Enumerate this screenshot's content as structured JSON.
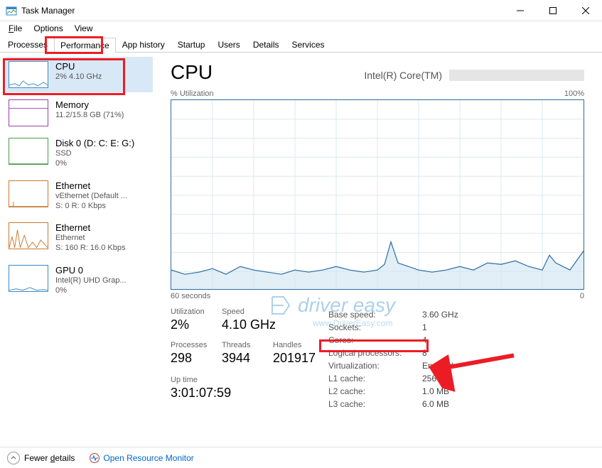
{
  "window": {
    "title": "Task Manager"
  },
  "menu": {
    "file": "File",
    "options": "Options",
    "view": "View"
  },
  "tabs": {
    "processes": "Processes",
    "performance": "Performance",
    "apphistory": "App history",
    "startup": "Startup",
    "users": "Users",
    "details": "Details",
    "services": "Services"
  },
  "sidebar": [
    {
      "name": "CPU",
      "sub1": "2%  4.10 GHz",
      "color": "#3b8bc4"
    },
    {
      "name": "Memory",
      "sub1": "11.2/15.8 GB (71%)",
      "color": "#9b3fb0"
    },
    {
      "name": "Disk 0 (D: C: E: G:)",
      "sub1": "SSD",
      "sub2": "0%",
      "color": "#4a9a4a"
    },
    {
      "name": "Ethernet",
      "sub1": "vEthernet (Default ...",
      "sub2": "S: 0  R: 0 Kbps",
      "color": "#c87b2e"
    },
    {
      "name": "Ethernet",
      "sub1": "Ethernet",
      "sub2": "S: 160  R: 16.0 Kbps",
      "color": "#c87b2e"
    },
    {
      "name": "GPU 0",
      "sub1": "Intel(R) UHD Grap...",
      "sub2": "0%",
      "color": "#3b8bc4"
    }
  ],
  "main": {
    "title": "CPU",
    "model": "Intel(R) Core(TM)",
    "util_label": "% Utilization",
    "util_max": "100%",
    "x_left": "60 seconds",
    "x_right": "0"
  },
  "stats_left": {
    "utilization_lbl": "Utilization",
    "utilization": "2%",
    "speed_lbl": "Speed",
    "speed": "4.10 GHz",
    "processes_lbl": "Processes",
    "processes": "298",
    "threads_lbl": "Threads",
    "threads": "3944",
    "handles_lbl": "Handles",
    "handles": "201917",
    "uptime_lbl": "Up time",
    "uptime": "3:01:07:59"
  },
  "stats_right": {
    "basespeed_lbl": "Base speed:",
    "basespeed": "3.60 GHz",
    "sockets_lbl": "Sockets:",
    "sockets": "1",
    "cores_lbl": "Cores:",
    "cores": "4",
    "lprocs_lbl": "Logical processors:",
    "lprocs": "8",
    "virt_lbl": "Virtualization:",
    "virt": "Enabled",
    "l1_lbl": "L1 cache:",
    "l1": "256 KB",
    "l2_lbl": "L2 cache:",
    "l2": "1.0 MB",
    "l3_lbl": "L3 cache:",
    "l3": "6.0 MB"
  },
  "bottom": {
    "fewer": "Fewer details",
    "fewer_key": "d",
    "orm": "Open Resource Monitor"
  },
  "watermark": {
    "text": "driver easy",
    "sub": "www.DriverEasy.com"
  },
  "chart_data": {
    "type": "line",
    "title": "% Utilization",
    "xlabel": "seconds",
    "ylabel": "% Utilization",
    "xlim": [
      60,
      0
    ],
    "ylim": [
      0,
      100
    ],
    "series": [
      {
        "name": "CPU",
        "x": [
          60,
          58,
          56,
          54,
          52,
          50,
          48,
          46,
          44,
          42,
          40,
          38,
          36,
          34,
          32,
          30,
          28,
          27,
          26,
          24,
          22,
          20,
          18,
          16,
          14,
          12,
          10,
          8,
          6,
          5,
          4,
          2,
          0
        ],
        "values": [
          10,
          8,
          9,
          11,
          8,
          12,
          10,
          9,
          8,
          10,
          9,
          10,
          12,
          10,
          9,
          10,
          13,
          25,
          14,
          10,
          9,
          10,
          12,
          10,
          14,
          13,
          15,
          12,
          10,
          18,
          14,
          10,
          20
        ]
      }
    ]
  }
}
